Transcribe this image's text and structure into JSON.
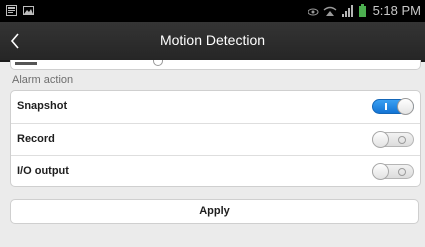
{
  "status_bar": {
    "time": "5:18 PM",
    "left_icons": [
      "notification-icon",
      "image-icon"
    ],
    "right_icons": [
      "eye-icon",
      "wifi-icon",
      "signal-icon",
      "battery-icon"
    ]
  },
  "header": {
    "title": "Motion Detection",
    "back_icon": "chevron-left-icon"
  },
  "section": {
    "label": "Alarm action"
  },
  "alarm_actions": [
    {
      "label": "Snapshot",
      "enabled": true
    },
    {
      "label": "Record",
      "enabled": false
    },
    {
      "label": "I/O output",
      "enabled": false
    }
  ],
  "apply_label": "Apply",
  "colors": {
    "toggle_on": "#1e88e5",
    "title_bar": "#2b2b2b",
    "background": "#ebebeb"
  }
}
